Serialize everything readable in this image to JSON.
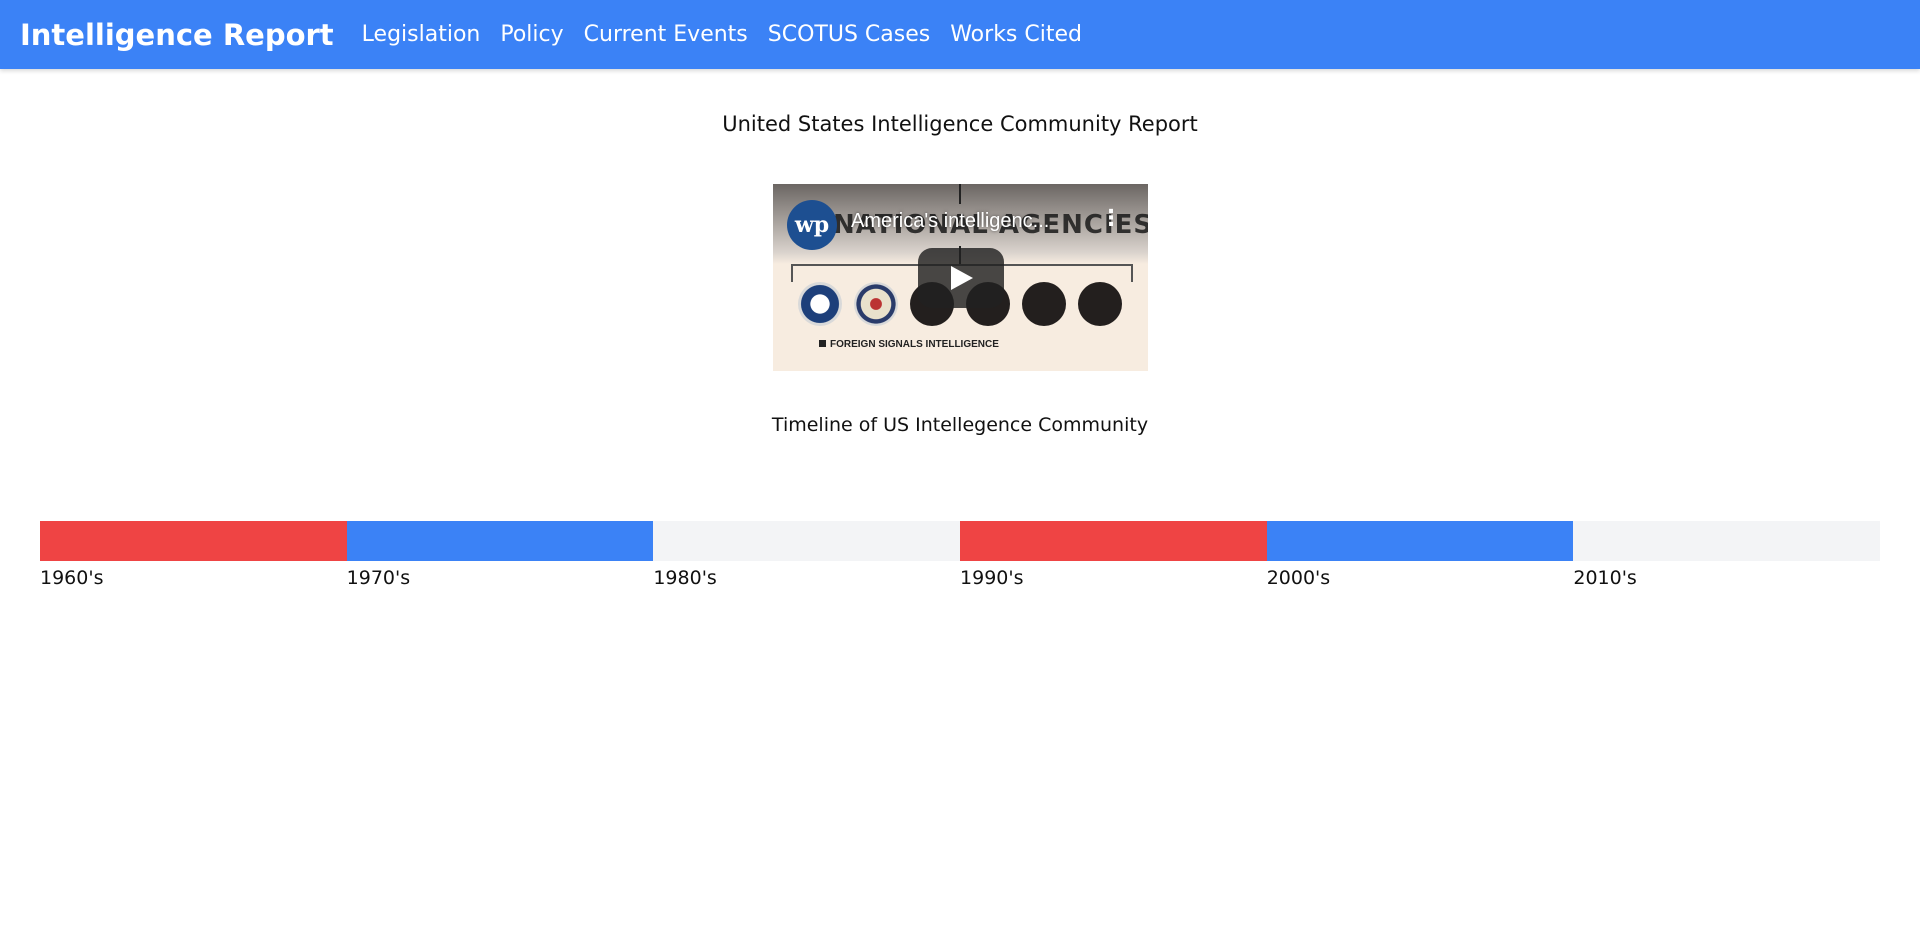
{
  "navbar": {
    "brand": "Intelligence Report",
    "links": [
      "Legislation",
      "Policy",
      "Current Events",
      "SCOTUS Cases",
      "Works Cited"
    ],
    "background_color": "#3b82f6"
  },
  "main": {
    "title": "United States Intelligence Community Report"
  },
  "video": {
    "channel_logo_text": "wp",
    "title": "America's intelligenc...",
    "background_text": "NATIONAL AGENCIES",
    "caption": "FOREIGN SIGNALS INTELLIGENCE",
    "menu_icon": "more-vert-icon",
    "play_icon": "play-icon"
  },
  "timeline": {
    "title": "Timeline of US Intellegence Community",
    "segments": [
      {
        "label": "1960's",
        "color": "#ef4444"
      },
      {
        "label": "1970's",
        "color": "#3b82f6"
      },
      {
        "label": "1980's",
        "color": "#f3f4f6"
      },
      {
        "label": "1990's",
        "color": "#ef4444"
      },
      {
        "label": "2000's",
        "color": "#3b82f6"
      },
      {
        "label": "2010's",
        "color": "#f3f4f6"
      }
    ]
  }
}
